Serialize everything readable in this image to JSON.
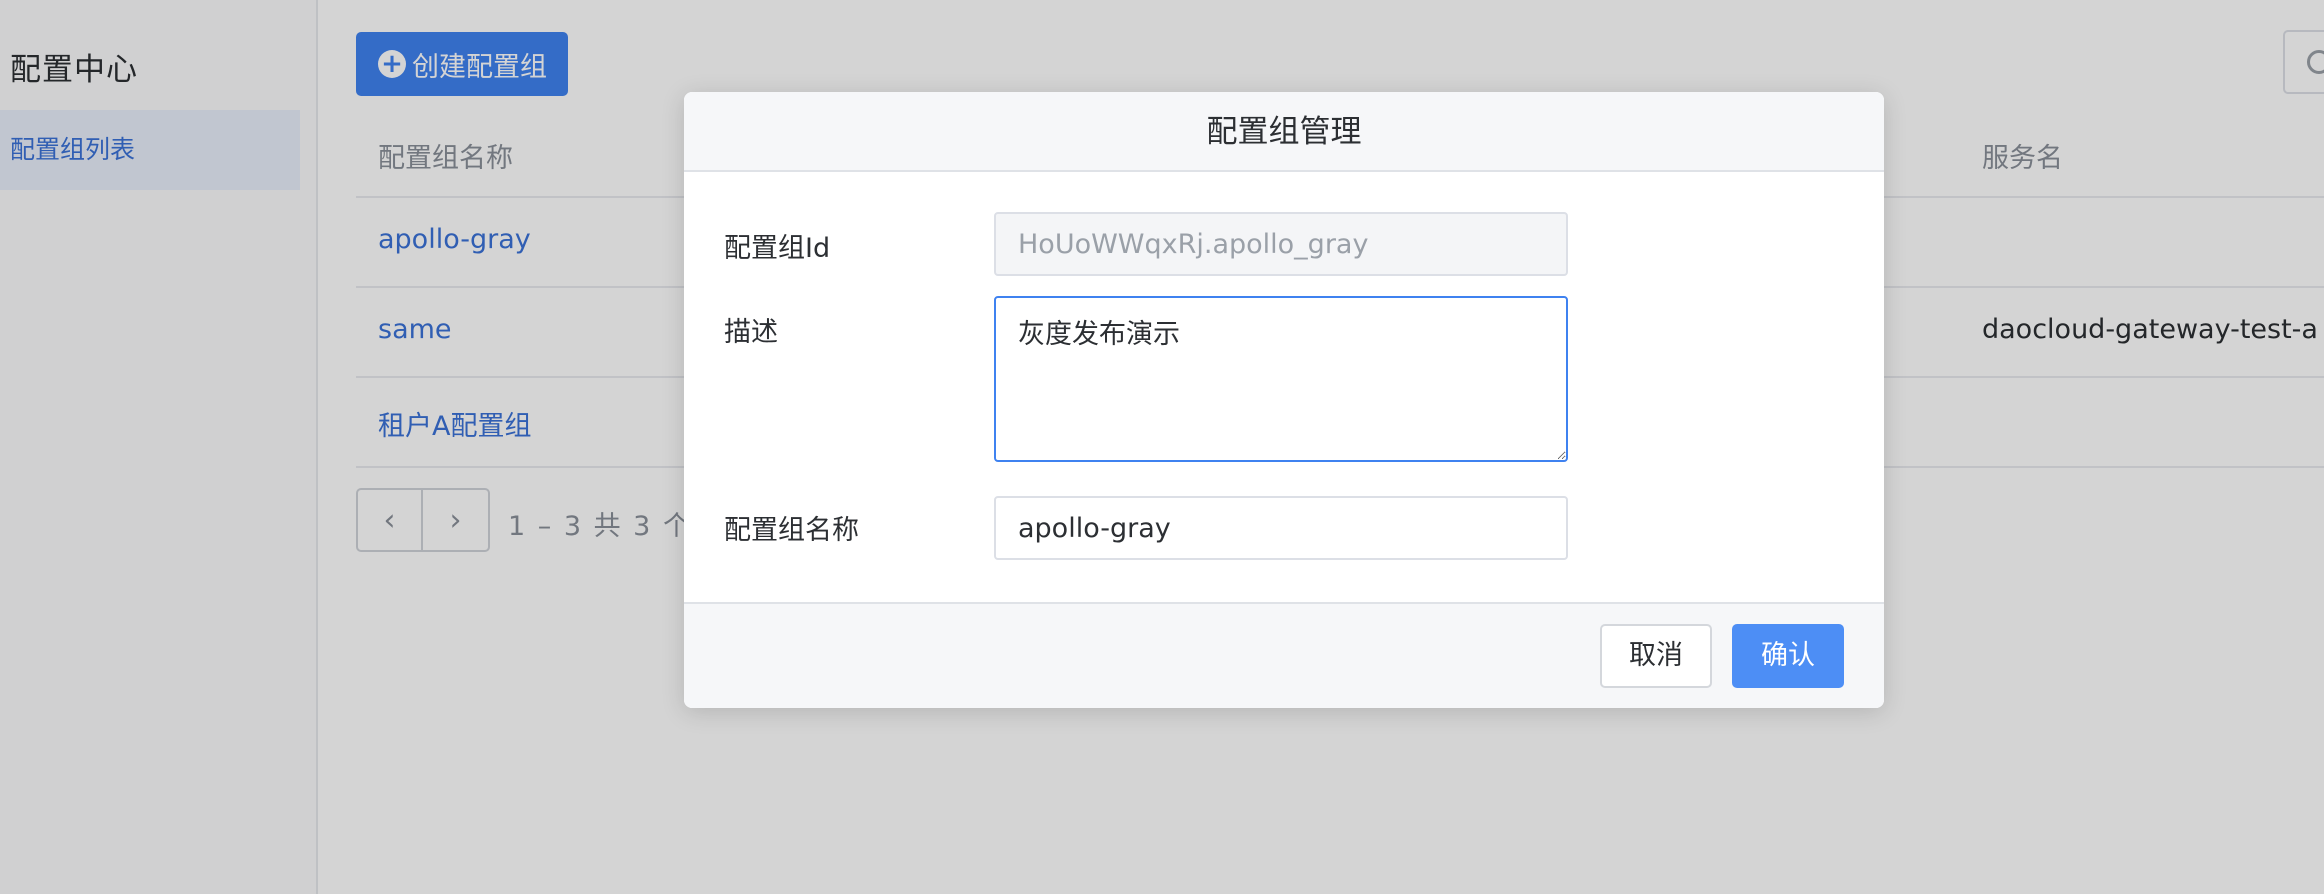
{
  "sidebar": {
    "title": "配置中心",
    "items": [
      {
        "label": "配置组列表"
      }
    ]
  },
  "toolbar": {
    "create_label": "创建配置组"
  },
  "table": {
    "columns": {
      "name": "配置组名称",
      "service": "服务名"
    },
    "rows": [
      {
        "name": "apollo-gray",
        "service": ""
      },
      {
        "name": "same",
        "service": "daocloud-gateway-test-a"
      },
      {
        "name": "租户A配置组",
        "service": ""
      }
    ]
  },
  "pagination": {
    "info": "1 – 3 共 3 个"
  },
  "modal": {
    "title": "配置组管理",
    "fields": {
      "id_label": "配置组Id",
      "id_value": "HoUoWWqxRj.apollo_gray",
      "desc_label": "描述",
      "desc_value": "灰度发布演示",
      "name_label": "配置组名称",
      "name_value": "apollo-gray"
    },
    "cancel_label": "取消",
    "confirm_label": "确认"
  },
  "colors": {
    "primary": "#3f82f0",
    "link": "#3a72d8",
    "sidebar_active_bg": "#e9effa"
  }
}
